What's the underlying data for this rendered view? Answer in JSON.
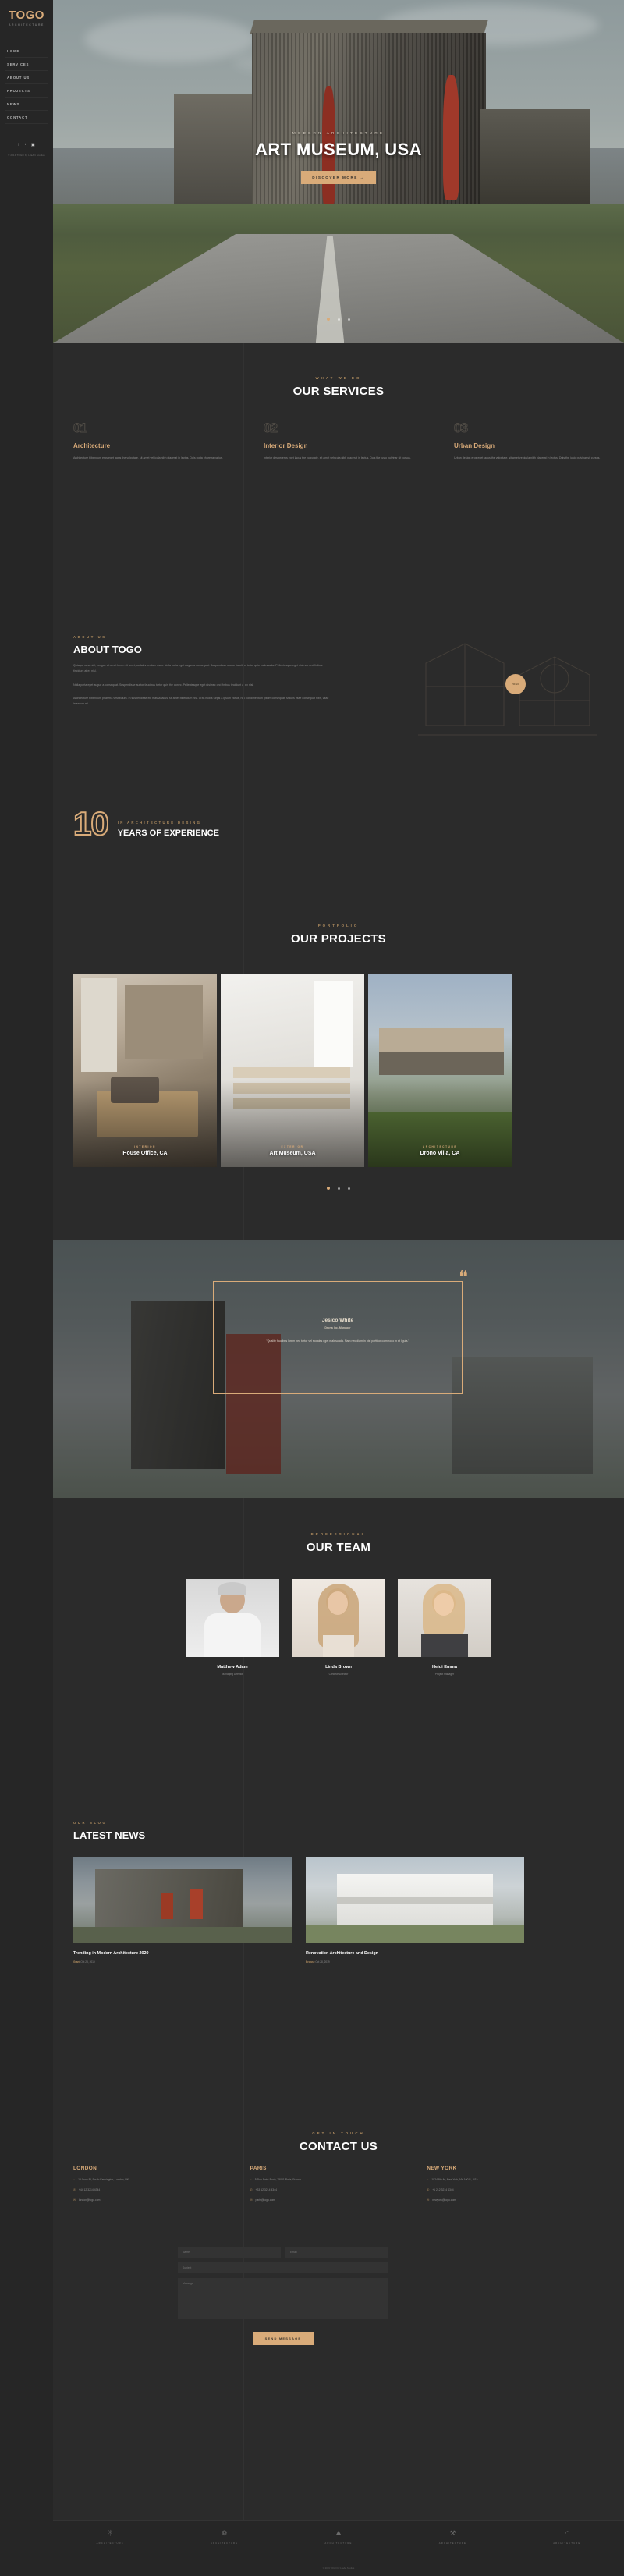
{
  "sidebar": {
    "logo": "TOGO",
    "logo_sub": "ARCHITECTURE",
    "nav": [
      {
        "label": "HOME"
      },
      {
        "label": "SERVICES"
      },
      {
        "label": "ABOUT US"
      },
      {
        "label": "PROJECTS"
      },
      {
        "label": "NEWS"
      },
      {
        "label": "CONTACT"
      }
    ],
    "socials": [
      {
        "name": "facebook-icon",
        "glyph": "f"
      },
      {
        "name": "twitter-icon",
        "glyph": "ᵗ"
      },
      {
        "name": "instagram-icon",
        "glyph": "▣"
      }
    ],
    "copyright": "© 2019 TOGO by LilaArt Studios"
  },
  "hero": {
    "kicker": "MODERN ARCHITECTURE",
    "title": "ART MUSEUM, USA",
    "button": "DISCOVER MORE",
    "button_arrow": "→",
    "dots": 3,
    "active_dot": 1
  },
  "services": {
    "kicker": "WHAT WE DO",
    "title": "OUR SERVICES",
    "cards": [
      {
        "num": "01",
        "title": "Architecture",
        "desc": "Architecture bibendum eros eget lacus the vulputate, sit amet vehicula nibh placerat in lectus. Duis porta pharetra varius."
      },
      {
        "num": "02",
        "title": "Interior Design",
        "desc": "Interior design eros eget lacus the vulputate, sit amet vehicula nibh placerat in lectus. Duis the justo pulvinar sit cursus."
      },
      {
        "num": "03",
        "title": "Urban Design",
        "desc": "Urban design eros eget lacus the vulputate, sit amet vehicula nibh placerat in lectus. Duis the justo pulvinar sit cursus."
      }
    ]
  },
  "about": {
    "kicker": "ABOUT US",
    "title": "ABOUT TOGO",
    "p1": "Quisque urna nisl, congue sit amet lorem sit amet, sodales pretium risus. Nulla porta eget augue a consequat. Suspendisse auctor faucibus tortor quis malesuada. Pellentesque eget nisi nec orci finibus tincidunt at ex nisl.",
    "p2": "Nulla porta eget augue a consequat. Suspendisse auctor faucibus tortor quis the donec. Pellentesque eget nisi nec orci finibus tincidunt at ex nisl.",
    "p3": "Architecture bibendum pharetra vestibulum. In suspendisse elit massa lacus, sit amet bibendum nisl. Cras mollis turpis a ipsum varius, nec condimentum ipsum consequat. Mauris vitae consequat nibh, vitae interdum mi.",
    "seal_text": "TOGO",
    "experience_number": "10",
    "experience_kicker": "IN ARCHITECTURE DESING",
    "experience_title": "YEARS OF EXPERIENCE"
  },
  "projects": {
    "kicker": "PORTFOLIO",
    "title": "OUR PROJECTS",
    "items": [
      {
        "sub": "INTERIOR",
        "name": "House Office, CA"
      },
      {
        "sub": "EXTERIOR",
        "name": "Art Museum, USA"
      },
      {
        "sub": "ARCHITECTURE",
        "name": "Drono Villa, CA"
      }
    ],
    "dots": 3,
    "active_dot": 1
  },
  "testimonial": {
    "name": "Jesico White",
    "role": "Drona Inc, Manager",
    "quote": "\"Quality faucibus lorem nec tortor vel sodales eget malesuada. Nam nec diam in nisl porttitor commodo in et ligula.\"",
    "quote_mark": "❝"
  },
  "team": {
    "kicker": "PROFESSIONAL",
    "title": "OUR TEAM",
    "members": [
      {
        "name": "Matthew Adam",
        "role": "Managing Director"
      },
      {
        "name": "Linda Brown",
        "role": "Creative Director"
      },
      {
        "name": "Heidi Emma",
        "role": "Project Manager"
      }
    ]
  },
  "news": {
    "kicker": "OUR BLOG",
    "title": "LATEST NEWS",
    "items": [
      {
        "title": "Trending in Modern Architecture 2020",
        "author": "Grant",
        "date": "Oct 28, 2019"
      },
      {
        "title": "Renovation Architecture and Design",
        "author": "Browse",
        "date": "Oct 28, 2019"
      }
    ]
  },
  "contact": {
    "kicker": "GET IN TOUCH",
    "title": "CONTACT US",
    "offices": [
      {
        "city": "LONDON",
        "address": "15 Crow Pl, South Kensington, London, UK",
        "phone": "+44 12 3214 4344",
        "email": "london@togo.com"
      },
      {
        "city": "PARIS",
        "address": "5 Rue Saint-Roch, 75001 Paris, France",
        "phone": "+33 12 3214 4344",
        "email": "paris@togo.com"
      },
      {
        "city": "NEW YORK",
        "address": "1824 8th Av, New York, NY 10011, USA",
        "phone": "+1 212 3214 4344",
        "email": "newyork@togo.com"
      }
    ],
    "icons": {
      "address": "⌂",
      "phone": "✆",
      "email": "✉"
    },
    "form": {
      "name_placeholder": "Name",
      "email_placeholder": "Email",
      "subject_placeholder": "Subject",
      "message_placeholder": "Message",
      "submit": "SEND MESSAGE"
    }
  },
  "footer": {
    "brands": [
      {
        "icon": "ᛡ",
        "label": "ARCHITECTURE"
      },
      {
        "icon": "❁",
        "label": "ARCHITECTURE"
      },
      {
        "icon": "⛰",
        "label": "ARCHITECTURE"
      },
      {
        "icon": "⚒",
        "label": "ARCHITECTURE"
      },
      {
        "icon": "◜",
        "label": "ARCHITECTURE"
      }
    ],
    "copyright": "© 2019 TOGO by LilaArt Studios"
  }
}
